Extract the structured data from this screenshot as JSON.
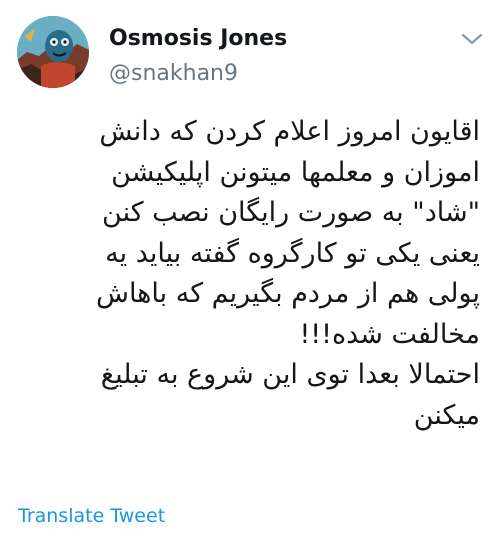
{
  "tweet": {
    "author": {
      "display_name": "Osmosis Jones",
      "handle": "@snakhan9",
      "avatar_icon": "avatar-image"
    },
    "menu_icon": "chevron-down-icon",
    "text_lines": [
      "اقایون امروز اعلام کردن که دانش",
      "اموزان و معلمها میتونن اپلیکیشن",
      "\"شاد\" به صورت رایگان نصب کنن",
      "یعنی یکی تو کارگروه گفته بیاید یه",
      "پولی هم از مردم بگیریم که باهاش",
      "مخالفت شده!!!",
      "احتمالا بعدا توی این شروع به تبلیغ",
      "میکنن"
    ],
    "translate_label": "Translate Tweet"
  },
  "colors": {
    "text": "#14171a",
    "secondary": "#657786",
    "link": "#1b95e0",
    "caret": "#8899a6"
  }
}
